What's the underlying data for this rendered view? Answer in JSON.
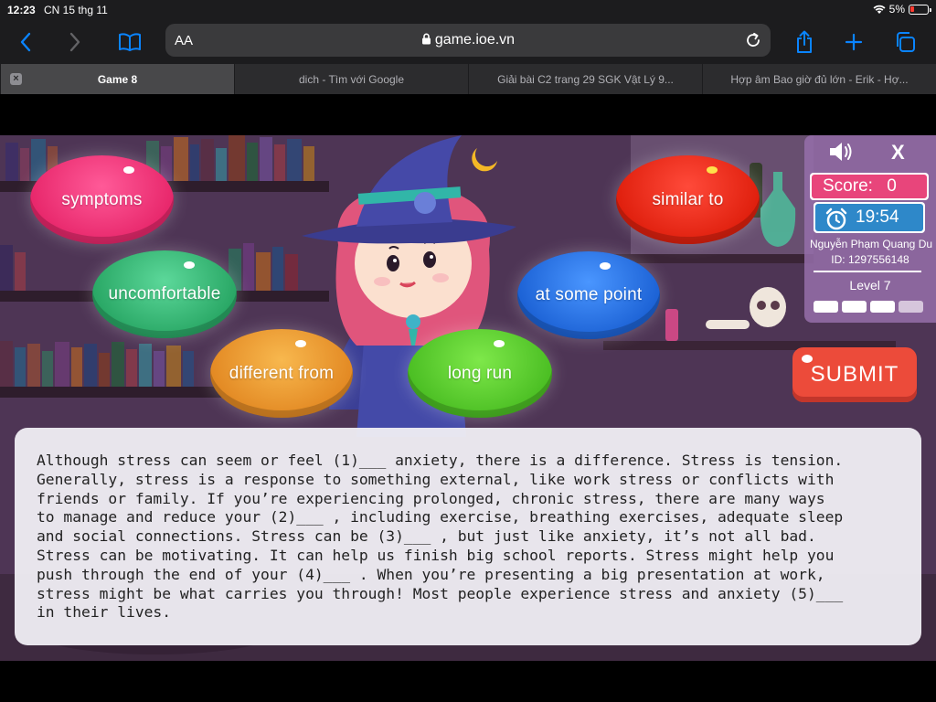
{
  "status": {
    "time": "12:23",
    "date": "CN 15 thg 11",
    "battery": "5%"
  },
  "browser": {
    "text_size_label": "AA",
    "url": "game.ioe.vn",
    "tabs": [
      {
        "label": "Game 8",
        "active": true
      },
      {
        "label": "dich - Tìm với Google",
        "active": false
      },
      {
        "label": "Giải bài C2 trang 29 SGK Vật Lý 9...",
        "active": false
      },
      {
        "label": "Hợp âm Bao giờ đủ lớn - Erik - Hợ...",
        "active": false
      }
    ]
  },
  "game": {
    "bubbles": [
      {
        "label": "symptoms",
        "color": "#f0397d"
      },
      {
        "label": "uncomfortable",
        "color": "#3fc07a"
      },
      {
        "label": "different from",
        "color": "#e8a23a"
      },
      {
        "label": "long run",
        "color": "#5ccf3c"
      },
      {
        "label": "at some point",
        "color": "#2f7be8"
      },
      {
        "label": "similar to",
        "color": "#f2301f"
      }
    ],
    "panel": {
      "close_label": "X",
      "score_label": "Score:",
      "score_value": "0",
      "timer": "19:54",
      "player_name": "Nguyễn Phạm Quang Du",
      "player_id": "ID: 1297556148",
      "level": "Level 7",
      "level_progress": {
        "completed": 3,
        "total": 4
      }
    },
    "submit_label": "SUBMIT",
    "passage_lines": [
      "Although stress can seem or feel (1)___ anxiety, there is a difference. Stress is tension.",
      "Generally, stress is a response to something external, like work stress or conflicts with",
      "friends or family. If you’re experiencing prolonged, chronic stress, there are many ways",
      "to manage and reduce your (2)___ , including exercise, breathing exercises, adequate sleep",
      "and social connections. Stress can be (3)___ , but just like anxiety, it’s not all bad.",
      "Stress can be motivating. It can help us finish big school reports. Stress might help you",
      "push through the end of your (4)___ . When you’re presenting a big presentation at work,",
      "stress might be what carries you through! Most people experience stress and anxiety (5)___",
      "in their lives."
    ]
  },
  "icons": {
    "back": "chevron-left-icon",
    "forward": "chevron-right-icon",
    "bookmarks": "book-icon",
    "lock": "lock-icon",
    "reload": "reload-icon",
    "share": "share-icon",
    "new_tab": "plus-icon",
    "tabs": "tabs-icon",
    "sound": "speaker-icon",
    "clock": "alarm-clock-icon",
    "wifi": "wifi-icon"
  }
}
